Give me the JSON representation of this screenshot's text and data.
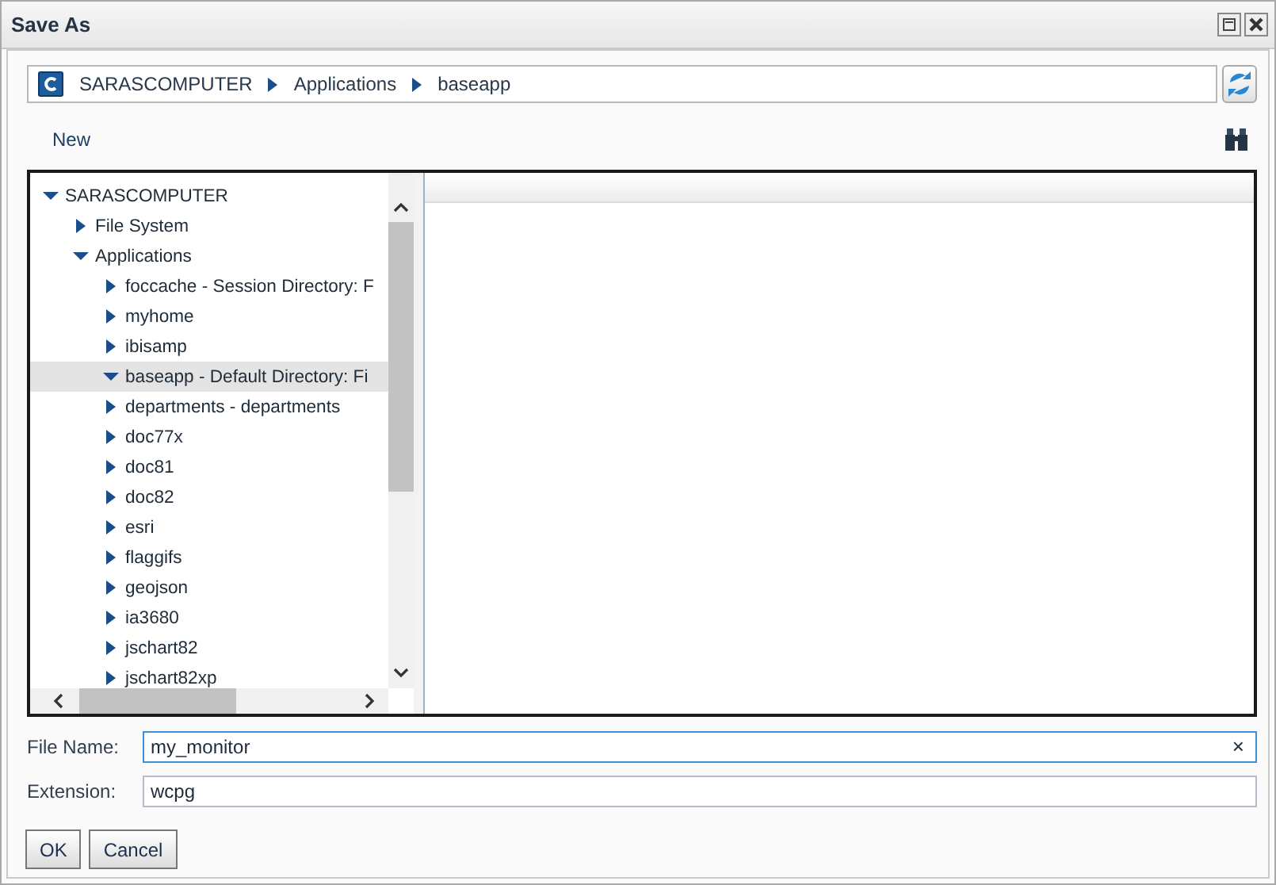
{
  "window": {
    "title": "Save As"
  },
  "breadcrumb": [
    "SARASCOMPUTER",
    "Applications",
    "baseapp"
  ],
  "toolbar": {
    "new_label": "New"
  },
  "tree": [
    {
      "label": "SARASCOMPUTER",
      "expanded": true,
      "selected": false,
      "children": [
        {
          "label": "File System",
          "expanded": false,
          "selected": false
        },
        {
          "label": "Applications",
          "expanded": true,
          "selected": false,
          "children": [
            {
              "label": "foccache - Session Directory: F",
              "expanded": false,
              "selected": false
            },
            {
              "label": "myhome",
              "expanded": false,
              "selected": false
            },
            {
              "label": "ibisamp",
              "expanded": false,
              "selected": false
            },
            {
              "label": "baseapp - Default Directory: Fi",
              "expanded": true,
              "selected": true
            },
            {
              "label": "departments - departments",
              "expanded": false,
              "selected": false
            },
            {
              "label": "doc77x",
              "expanded": false,
              "selected": false
            },
            {
              "label": "doc81",
              "expanded": false,
              "selected": false
            },
            {
              "label": "doc82",
              "expanded": false,
              "selected": false
            },
            {
              "label": "esri",
              "expanded": false,
              "selected": false
            },
            {
              "label": "flaggifs",
              "expanded": false,
              "selected": false
            },
            {
              "label": "geojson",
              "expanded": false,
              "selected": false
            },
            {
              "label": "ia3680",
              "expanded": false,
              "selected": false
            },
            {
              "label": "jschart82",
              "expanded": false,
              "selected": false
            },
            {
              "label": "jschart82xp",
              "expanded": false,
              "selected": false
            }
          ]
        }
      ]
    }
  ],
  "fields": [
    {
      "label": "File Name:",
      "value": "my_monitor",
      "focused": true,
      "clear": "×"
    },
    {
      "label": "Extension:",
      "value": "wcpg",
      "focused": false
    }
  ],
  "buttons": [
    "OK",
    "Cancel"
  ]
}
